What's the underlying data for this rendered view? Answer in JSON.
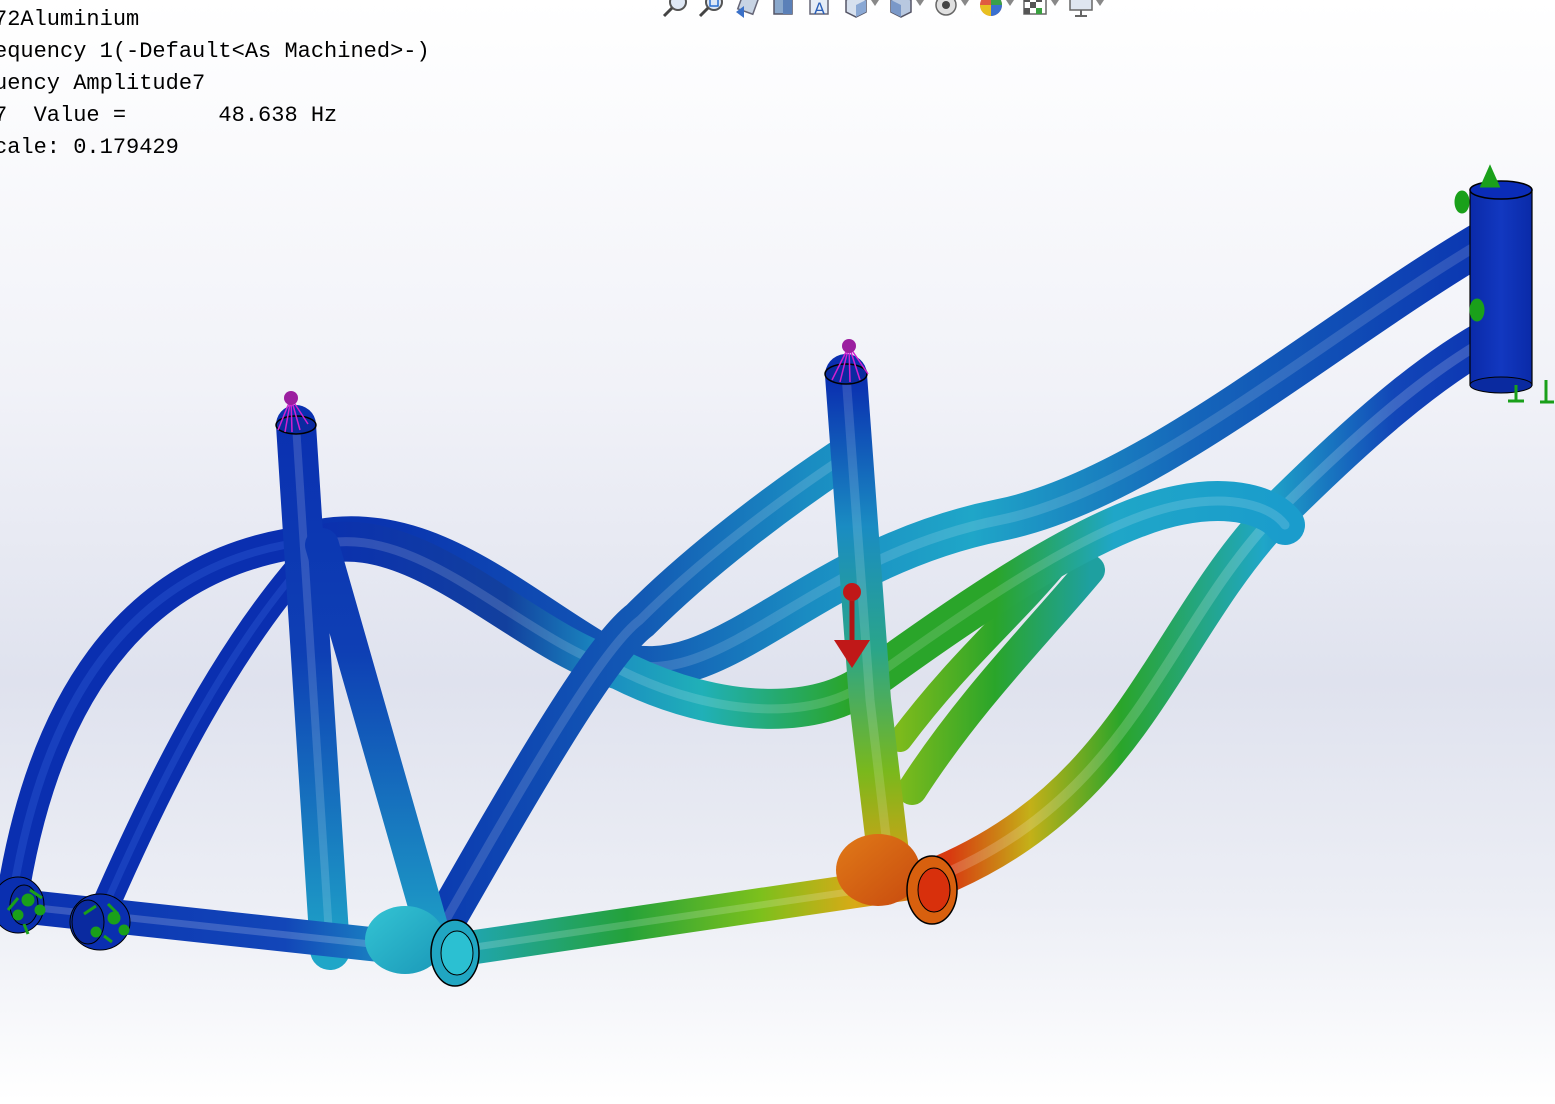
{
  "study_info": {
    "material_line": "72Aluminium",
    "study_line": "equency 1(-Default<As Machined>-)",
    "plot_line": "uency Amplitude7",
    "mode_line": "7  Value =       48.638 Hz",
    "scale_line": "cale: 0.179429"
  },
  "toolbar": {
    "buttons": [
      {
        "name": "zoom-to-fit-icon",
        "has_dropdown": false
      },
      {
        "name": "zoom-to-area-icon",
        "has_dropdown": false
      },
      {
        "name": "previous-view-icon",
        "has_dropdown": false
      },
      {
        "name": "section-view-icon",
        "has_dropdown": false
      },
      {
        "name": "dynamic-annotation-icon",
        "has_dropdown": false
      },
      {
        "name": "view-orientation-icon",
        "has_dropdown": true
      },
      {
        "name": "display-style-icon",
        "has_dropdown": true
      },
      {
        "name": "hide-show-items-icon",
        "has_dropdown": true
      },
      {
        "name": "edit-appearance-icon",
        "has_dropdown": true
      },
      {
        "name": "apply-scene-icon",
        "has_dropdown": true
      },
      {
        "name": "view-settings-icon",
        "has_dropdown": true
      }
    ]
  },
  "model": {
    "name": "bicycle-frame",
    "result": "frequency-amplitude-mode-shape",
    "colors": {
      "low": "#0a2fb0",
      "mid_low": "#1fa6c8",
      "mid": "#2aa52a",
      "mid_high": "#c8c81e",
      "high": "#d83a10",
      "fixture": "#1aa01a",
      "remote_load": "#9b1fa0",
      "force": "#c01818"
    }
  }
}
